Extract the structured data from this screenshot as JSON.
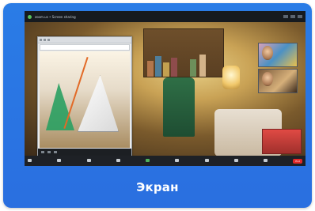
{
  "card": {
    "label": "Экран",
    "accent": "#2a7ce6"
  },
  "meeting": {
    "window_title": "zoom.us • Screen sharing",
    "video_bg": "#7a5a2c",
    "toolbar_items": [
      "unmute-icon",
      "video-icon",
      "security-icon",
      "participants-icon",
      "chat-icon",
      "share-screen-icon",
      "record-icon",
      "reactions-icon",
      "apps-icon"
    ],
    "end_label": "End"
  }
}
